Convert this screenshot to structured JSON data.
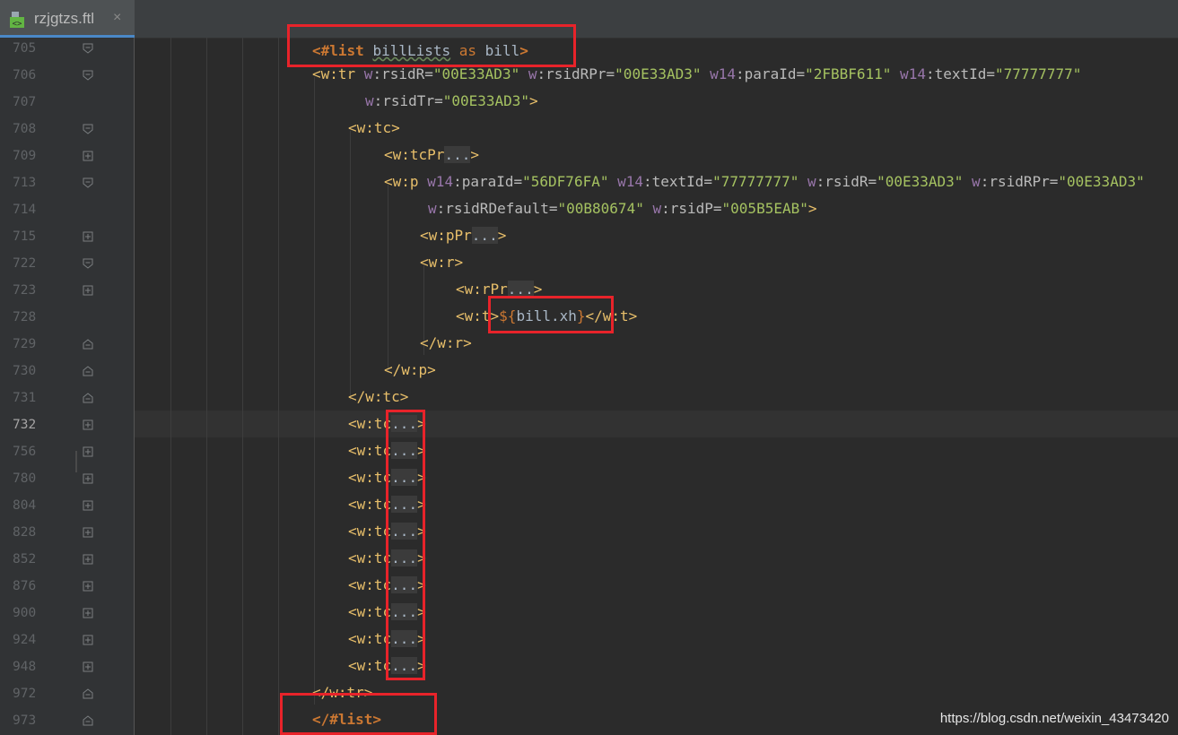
{
  "tab": {
    "filename": "rzjgtzs.ftl",
    "close_glyph": "×",
    "icon": "ftl-file-icon"
  },
  "gutter": {
    "line_numbers": [
      "705",
      "706",
      "707",
      "708",
      "709",
      "713",
      "714",
      "715",
      "722",
      "723",
      "728",
      "729",
      "730",
      "731",
      "732",
      "756",
      "780",
      "804",
      "828",
      "852",
      "876",
      "900",
      "924",
      "948",
      "972",
      "973"
    ],
    "current_line": "732"
  },
  "code": {
    "l705": {
      "open": "<#list ",
      "var": "billLists",
      "as": " as ",
      "item": "bill",
      "close": ">"
    },
    "l706": {
      "t1": "<w:tr ",
      "a1ns": "w",
      "a1": ":rsidR=",
      "v1": "\"00E33AD3\"",
      "a2ns": " w",
      "a2": ":rsidRPr=",
      "v2": "\"00E33AD3\"",
      "a3ns": " w14",
      "a3": ":paraId=",
      "v3": "\"2FBBF611\"",
      "a4ns": " w14",
      "a4": ":textId=",
      "v4": "\"77777777\""
    },
    "l707": {
      "ans": "w",
      "a": ":rsidTr=",
      "v": "\"00E33AD3\"",
      "close": ">"
    },
    "l708": "<w:tc>",
    "l709": {
      "t": "<w:tcPr",
      "ph": "...",
      "close": ">"
    },
    "l713": {
      "t": "<w:p ",
      "a1ns": "w14",
      "a1": ":paraId=",
      "v1": "\"56DF76FA\"",
      "a2ns": " w14",
      "a2": ":textId=",
      "v2": "\"77777777\"",
      "a3ns": " w",
      "a3": ":rsidR=",
      "v3": "\"00E33AD3\"",
      "a4ns": " w",
      "a4": ":rsidRPr=",
      "v4": "\"00E33AD3\""
    },
    "l714": {
      "a1ns": "w",
      "a1": ":rsidRDefault=",
      "v1": "\"00B80674\"",
      "a2ns": " w",
      "a2": ":rsidP=",
      "v2": "\"005B5EAB\"",
      "close": ">"
    },
    "l715": {
      "t": "<w:pPr",
      "ph": "...",
      "close": ">"
    },
    "l722": "<w:r>",
    "l723": {
      "t": "<w:rPr",
      "ph": "...",
      "close": ">"
    },
    "l728": {
      "open": "<w:t>",
      "ex_open": "${",
      "ex": "bill.xh",
      "ex_close": "}",
      "close": "</w:t>"
    },
    "l729": "</w:r>",
    "l730": "</w:p>",
    "l731": "</w:tc>",
    "tc_collapsed": {
      "t": "<w:tc",
      "ph": "...",
      "close": ">"
    },
    "l972": "</w:tr>",
    "l973": "</#list>"
  },
  "watermark": "https://blog.csdn.net/weixin_43473420",
  "colors": {
    "highlight_box": "#e8232a",
    "background": "#2b2b2b",
    "tag": "#e8bf6a",
    "value": "#a5c261",
    "namespace": "#9876aa",
    "keyword": "#cc7832"
  }
}
